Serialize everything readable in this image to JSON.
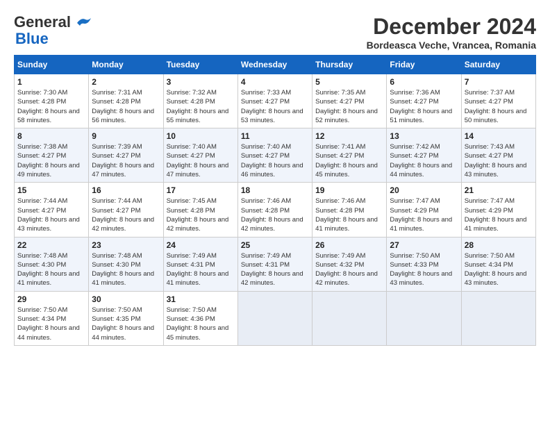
{
  "logo": {
    "line1": "General",
    "line2": "Blue"
  },
  "title": "December 2024",
  "subtitle": "Bordeasca Veche, Vrancea, Romania",
  "days_of_week": [
    "Sunday",
    "Monday",
    "Tuesday",
    "Wednesday",
    "Thursday",
    "Friday",
    "Saturday"
  ],
  "weeks": [
    [
      {
        "day": 1,
        "sunrise": "Sunrise: 7:30 AM",
        "sunset": "Sunset: 4:28 PM",
        "daylight": "Daylight: 8 hours and 58 minutes."
      },
      {
        "day": 2,
        "sunrise": "Sunrise: 7:31 AM",
        "sunset": "Sunset: 4:28 PM",
        "daylight": "Daylight: 8 hours and 56 minutes."
      },
      {
        "day": 3,
        "sunrise": "Sunrise: 7:32 AM",
        "sunset": "Sunset: 4:28 PM",
        "daylight": "Daylight: 8 hours and 55 minutes."
      },
      {
        "day": 4,
        "sunrise": "Sunrise: 7:33 AM",
        "sunset": "Sunset: 4:27 PM",
        "daylight": "Daylight: 8 hours and 53 minutes."
      },
      {
        "day": 5,
        "sunrise": "Sunrise: 7:35 AM",
        "sunset": "Sunset: 4:27 PM",
        "daylight": "Daylight: 8 hours and 52 minutes."
      },
      {
        "day": 6,
        "sunrise": "Sunrise: 7:36 AM",
        "sunset": "Sunset: 4:27 PM",
        "daylight": "Daylight: 8 hours and 51 minutes."
      },
      {
        "day": 7,
        "sunrise": "Sunrise: 7:37 AM",
        "sunset": "Sunset: 4:27 PM",
        "daylight": "Daylight: 8 hours and 50 minutes."
      }
    ],
    [
      {
        "day": 8,
        "sunrise": "Sunrise: 7:38 AM",
        "sunset": "Sunset: 4:27 PM",
        "daylight": "Daylight: 8 hours and 49 minutes."
      },
      {
        "day": 9,
        "sunrise": "Sunrise: 7:39 AM",
        "sunset": "Sunset: 4:27 PM",
        "daylight": "Daylight: 8 hours and 47 minutes."
      },
      {
        "day": 10,
        "sunrise": "Sunrise: 7:40 AM",
        "sunset": "Sunset: 4:27 PM",
        "daylight": "Daylight: 8 hours and 47 minutes."
      },
      {
        "day": 11,
        "sunrise": "Sunrise: 7:40 AM",
        "sunset": "Sunset: 4:27 PM",
        "daylight": "Daylight: 8 hours and 46 minutes."
      },
      {
        "day": 12,
        "sunrise": "Sunrise: 7:41 AM",
        "sunset": "Sunset: 4:27 PM",
        "daylight": "Daylight: 8 hours and 45 minutes."
      },
      {
        "day": 13,
        "sunrise": "Sunrise: 7:42 AM",
        "sunset": "Sunset: 4:27 PM",
        "daylight": "Daylight: 8 hours and 44 minutes."
      },
      {
        "day": 14,
        "sunrise": "Sunrise: 7:43 AM",
        "sunset": "Sunset: 4:27 PM",
        "daylight": "Daylight: 8 hours and 43 minutes."
      }
    ],
    [
      {
        "day": 15,
        "sunrise": "Sunrise: 7:44 AM",
        "sunset": "Sunset: 4:27 PM",
        "daylight": "Daylight: 8 hours and 43 minutes."
      },
      {
        "day": 16,
        "sunrise": "Sunrise: 7:44 AM",
        "sunset": "Sunset: 4:27 PM",
        "daylight": "Daylight: 8 hours and 42 minutes."
      },
      {
        "day": 17,
        "sunrise": "Sunrise: 7:45 AM",
        "sunset": "Sunset: 4:28 PM",
        "daylight": "Daylight: 8 hours and 42 minutes."
      },
      {
        "day": 18,
        "sunrise": "Sunrise: 7:46 AM",
        "sunset": "Sunset: 4:28 PM",
        "daylight": "Daylight: 8 hours and 42 minutes."
      },
      {
        "day": 19,
        "sunrise": "Sunrise: 7:46 AM",
        "sunset": "Sunset: 4:28 PM",
        "daylight": "Daylight: 8 hours and 41 minutes."
      },
      {
        "day": 20,
        "sunrise": "Sunrise: 7:47 AM",
        "sunset": "Sunset: 4:29 PM",
        "daylight": "Daylight: 8 hours and 41 minutes."
      },
      {
        "day": 21,
        "sunrise": "Sunrise: 7:47 AM",
        "sunset": "Sunset: 4:29 PM",
        "daylight": "Daylight: 8 hours and 41 minutes."
      }
    ],
    [
      {
        "day": 22,
        "sunrise": "Sunrise: 7:48 AM",
        "sunset": "Sunset: 4:30 PM",
        "daylight": "Daylight: 8 hours and 41 minutes."
      },
      {
        "day": 23,
        "sunrise": "Sunrise: 7:48 AM",
        "sunset": "Sunset: 4:30 PM",
        "daylight": "Daylight: 8 hours and 41 minutes."
      },
      {
        "day": 24,
        "sunrise": "Sunrise: 7:49 AM",
        "sunset": "Sunset: 4:31 PM",
        "daylight": "Daylight: 8 hours and 41 minutes."
      },
      {
        "day": 25,
        "sunrise": "Sunrise: 7:49 AM",
        "sunset": "Sunset: 4:31 PM",
        "daylight": "Daylight: 8 hours and 42 minutes."
      },
      {
        "day": 26,
        "sunrise": "Sunrise: 7:49 AM",
        "sunset": "Sunset: 4:32 PM",
        "daylight": "Daylight: 8 hours and 42 minutes."
      },
      {
        "day": 27,
        "sunrise": "Sunrise: 7:50 AM",
        "sunset": "Sunset: 4:33 PM",
        "daylight": "Daylight: 8 hours and 43 minutes."
      },
      {
        "day": 28,
        "sunrise": "Sunrise: 7:50 AM",
        "sunset": "Sunset: 4:34 PM",
        "daylight": "Daylight: 8 hours and 43 minutes."
      }
    ],
    [
      {
        "day": 29,
        "sunrise": "Sunrise: 7:50 AM",
        "sunset": "Sunset: 4:34 PM",
        "daylight": "Daylight: 8 hours and 44 minutes."
      },
      {
        "day": 30,
        "sunrise": "Sunrise: 7:50 AM",
        "sunset": "Sunset: 4:35 PM",
        "daylight": "Daylight: 8 hours and 44 minutes."
      },
      {
        "day": 31,
        "sunrise": "Sunrise: 7:50 AM",
        "sunset": "Sunset: 4:36 PM",
        "daylight": "Daylight: 8 hours and 45 minutes."
      },
      null,
      null,
      null,
      null
    ]
  ]
}
